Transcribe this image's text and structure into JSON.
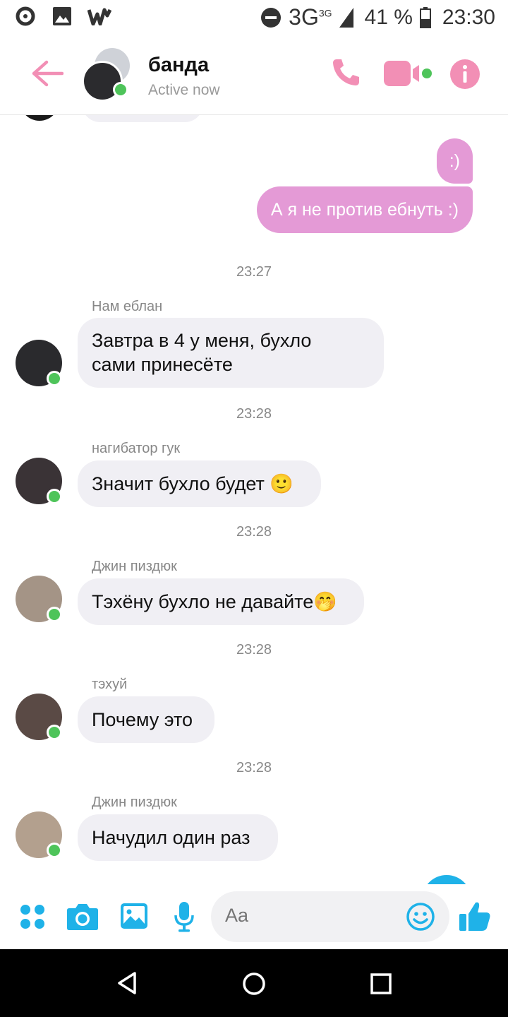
{
  "status_bar": {
    "network": "3G",
    "network_sup": "3G",
    "battery": "41 %",
    "time": "23:30",
    "left_icons": [
      "notification-icon",
      "image-icon",
      "wattpad-icon"
    ]
  },
  "header": {
    "title": "банда",
    "subtitle": "Active now",
    "accent_color": "#f28fb5"
  },
  "outgoing": [
    {
      "text": ":)"
    },
    {
      "text": "А я не против ебнуть :)"
    }
  ],
  "messages": [
    {
      "time": "23:27",
      "sender": "Нам еблан",
      "lines": [
        "Завтра в 4 у меня, бухло",
        "сами принесёте"
      ]
    },
    {
      "time": "23:28",
      "sender": "нагибатор гук",
      "lines": [
        "Значит бухло будет 🙂"
      ]
    },
    {
      "time": "23:28",
      "sender": "Джин пиздюк",
      "lines": [
        "Тэхёну бухло не давайте🤭"
      ]
    },
    {
      "time": "23:28",
      "sender": "тэхуй",
      "lines": [
        "Почему это"
      ]
    },
    {
      "time": "23:28",
      "sender": "Джин пиздюк",
      "lines": [
        "Начудил один раз"
      ]
    }
  ],
  "composer": {
    "placeholder": "Aa",
    "accent_color": "#1fb2e8"
  }
}
